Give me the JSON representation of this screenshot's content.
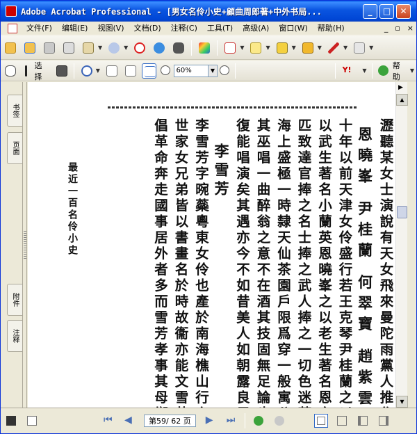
{
  "window": {
    "title": "Adobe Acrobat Professional - [男女名伶小史+顧曲周郎著+中外书局..."
  },
  "menu": {
    "items": [
      "文件(F)",
      "编辑(E)",
      "视图(V)",
      "文档(D)",
      "注释(C)",
      "工具(T)",
      "高级(A)",
      "窗口(W)",
      "帮助(H)"
    ],
    "right_controls": [
      "_",
      "▫",
      "×"
    ]
  },
  "toolbar2": {
    "select_label": "选择",
    "zoom_value": "60%",
    "help_label": "帮助"
  },
  "left_tabs": {
    "bookmarks": "书签",
    "pages": "页面",
    "attachments": "附件",
    "comments": "注释"
  },
  "document": {
    "running_head": "最近一百名伶小史",
    "columns": [
      "瀝聽某女士演說有天女飛來曼陀雨黨人推作菊花",
      "恩曉峯  尹桂蘭  何翠寶  趙紫雲",
      "十年以前天津女伶盛行若王克琴尹桂蘭之以花旦",
      "以武生著名小蘭英恩曉峯之以老生著名恩之老生",
      "匹致達官捧之名士捧之武人捧之一切色迷莫不大",
      "海上盛極一時隸天仙茶園戶限爲穿一般寓公派之",
      "其巫唱一曲醉翁之意不在酒其技固無足論也恩至",
      "復能唱演矣其遇亦今不如昔美人如朝露良足惜也",
      "李雪芳",
      "李雪芳字晼蘂粵東女伶也產於南海樵山行六人以",
      "世家女兄弟皆以書畫名於時故衞亦能文雪芳得其",
      "倡革命奔走國事居外者多而雪芳孝事其母鄉里稱"
    ]
  },
  "statusbar": {
    "page_label": "第59/ 62 页"
  },
  "colors": {
    "titlebar": "#0a54e0",
    "chrome": "#ece9d8"
  }
}
